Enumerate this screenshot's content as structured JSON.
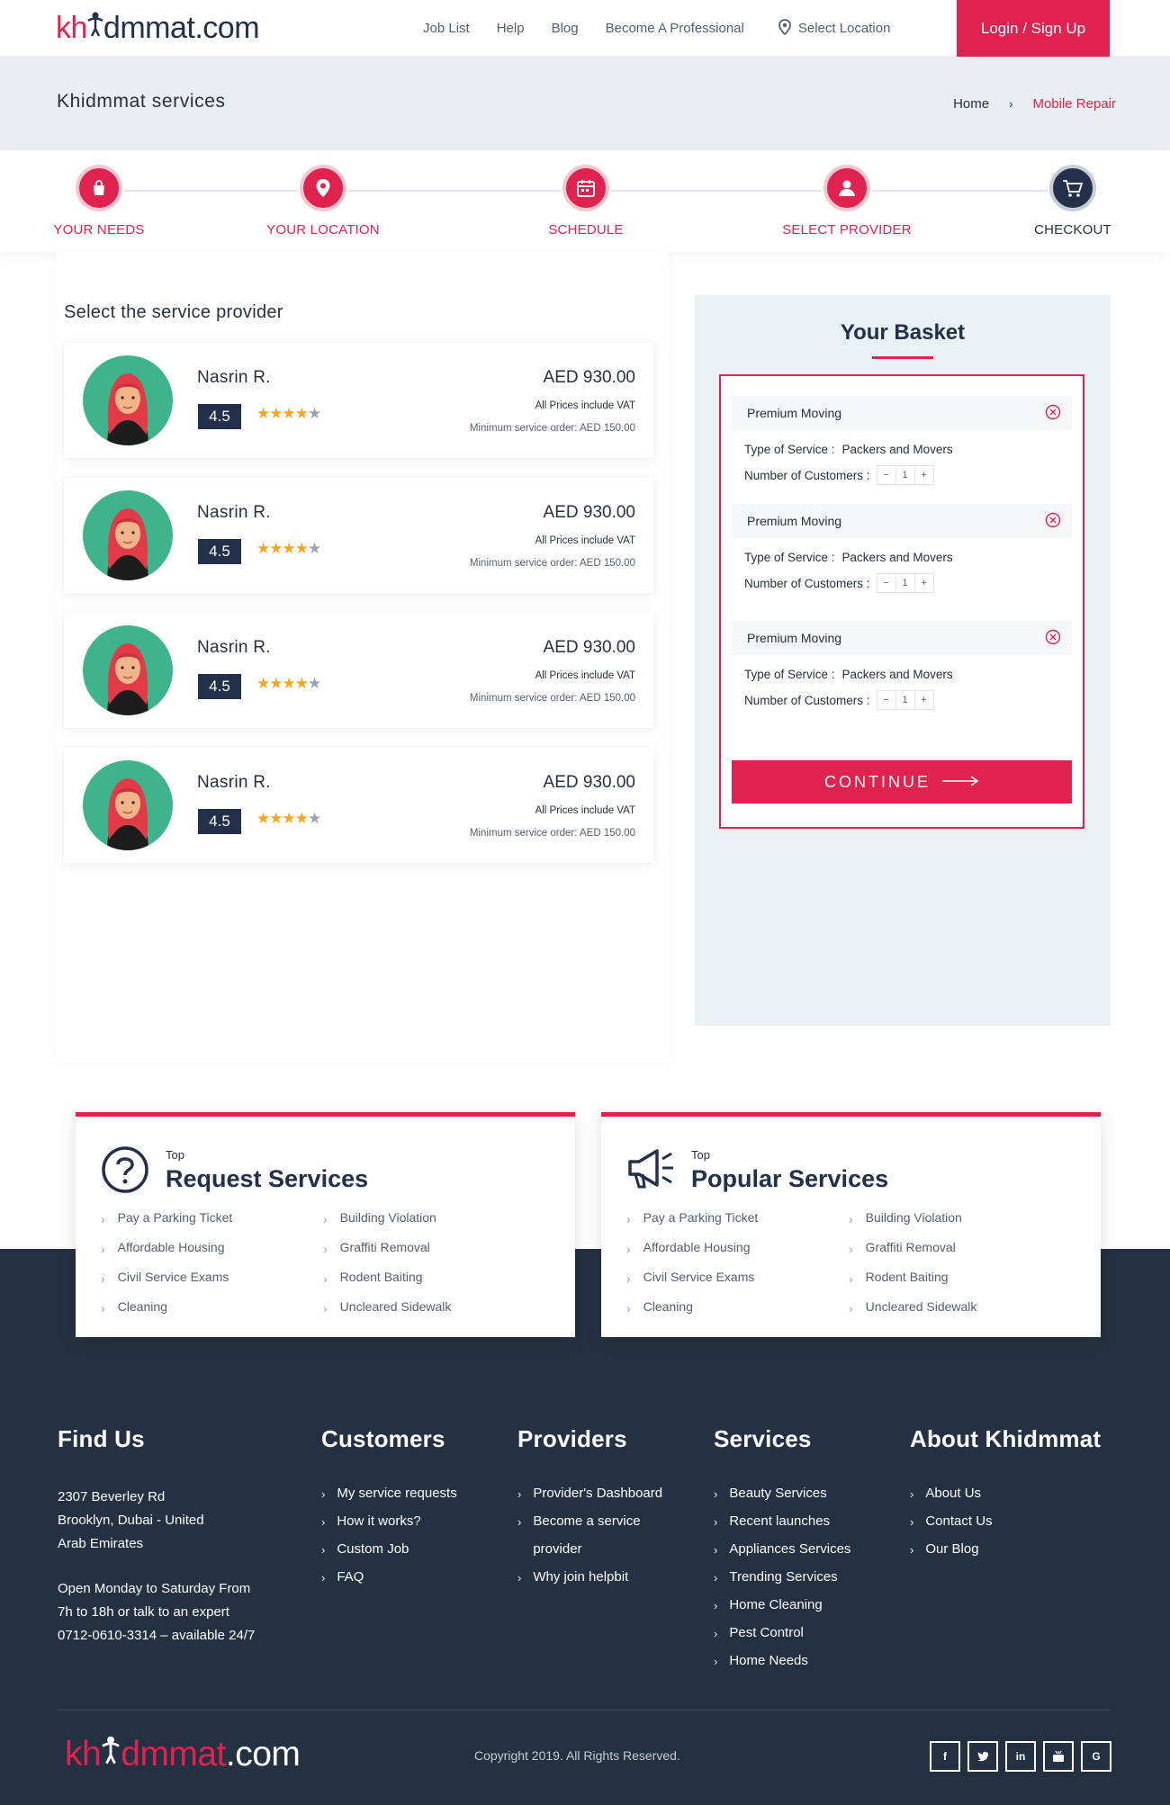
{
  "brand": {
    "logo_pre": "kh",
    "logo_post": "dmmat",
    "logo_tld": ".com"
  },
  "nav": {
    "job_list": "Job List",
    "help": "Help",
    "blog": "Blog",
    "become_pro": "Become A Professional",
    "location": "Select Location",
    "login": "Login / Sign Up"
  },
  "band": {
    "title": "Khidmmat services",
    "crumb_home": "Home",
    "crumb_sep": "›",
    "crumb_current": "Mobile Repair"
  },
  "steps": [
    {
      "label": "YOUR NEEDS",
      "icon": "shopping-bag-icon"
    },
    {
      "label": "YOUR LOCATION",
      "icon": "location-pin-icon"
    },
    {
      "label": "SCHEDULE",
      "icon": "calendar-icon"
    },
    {
      "label": "SELECT PROVIDER",
      "icon": "user-icon"
    },
    {
      "label": "CHECKOUT",
      "icon": "cart-icon"
    }
  ],
  "providers_heading": "Select the service provider",
  "providers": [
    {
      "name": "Nasrin R.",
      "rating": "4.5",
      "stars": "★★★★",
      "half": "★",
      "price": "AED 930.00",
      "vat": "All Prices include VAT",
      "min": "Minimum service order: AED 150.00"
    },
    {
      "name": "Nasrin R.",
      "rating": "4.5",
      "stars": "★★★★",
      "half": "★",
      "price": "AED 930.00",
      "vat": "All Prices include VAT",
      "min": "Minimum service order: AED 150.00"
    },
    {
      "name": "Nasrin R.",
      "rating": "4.5",
      "stars": "★★★★",
      "half": "★",
      "price": "AED 930.00",
      "vat": "All Prices include VAT",
      "min": "Minimum service order: AED 150.00"
    },
    {
      "name": "Nasrin R.",
      "rating": "4.5",
      "stars": "★★★★",
      "half": "★",
      "price": "AED 930.00",
      "vat": "All Prices include VAT",
      "min": "Minimum service order: AED 150.00"
    }
  ],
  "basket": {
    "title": "Your Basket",
    "type_label": "Type of Service :",
    "count_label": "Number of Customers :",
    "minus": "−",
    "plus": "+",
    "items": [
      {
        "name": "Premium Moving",
        "type": "Packers and Movers",
        "count": "1"
      },
      {
        "name": "Premium Moving",
        "type": "Packers and Movers",
        "count": "1"
      },
      {
        "name": "Premium Moving",
        "type": "Packers and Movers",
        "count": "1"
      }
    ],
    "continue": "CONTINUE"
  },
  "service_cards": [
    {
      "small": "Top",
      "big": "Request Services",
      "icon": "question-circle-icon",
      "col1": [
        "Pay a Parking Ticket",
        "Affordable Housing",
        "Civil Service Exams",
        "Cleaning"
      ],
      "col2": [
        "Building Violation",
        "Graffiti Removal",
        "Rodent Baiting",
        "Uncleared Sidewalk"
      ]
    },
    {
      "small": "Top",
      "big": "Popular Services",
      "icon": "megaphone-icon",
      "col1": [
        "Pay a Parking Ticket",
        "Affordable Housing",
        "Civil Service Exams",
        "Cleaning"
      ],
      "col2": [
        "Building Violation",
        "Graffiti Removal",
        "Rodent Baiting",
        "Uncleared Sidewalk"
      ]
    }
  ],
  "footer": {
    "find_us": {
      "title": "Find Us",
      "addr1": "2307 Beverley Rd",
      "addr2": "Brooklyn, Dubai - United",
      "addr3": "Arab Emirates",
      "hours1": "Open Monday to Saturday From",
      "hours2": "7h to 18h or talk to an expert",
      "hours3": "0712-0610-3314 – available 24/7"
    },
    "customers": {
      "title": "Customers",
      "links": [
        "My service requests",
        "How it works?",
        "Custom Job",
        "FAQ"
      ]
    },
    "providers": {
      "title": "Providers",
      "links": [
        "Provider's Dashboard",
        "Become a service",
        "provider",
        "Why join helpbit"
      ]
    },
    "services": {
      "title": "Services",
      "links": [
        "Beauty Services",
        "Recent launches",
        "Appliances Services",
        "Trending Services",
        "Home Cleaning",
        "Pest Control",
        "Home Needs"
      ]
    },
    "about": {
      "title": "About Khidmmat",
      "links": [
        "About Us",
        "Contact Us",
        "Our Blog"
      ]
    },
    "copyright": "Copyright 2019. All Rights Reserved.",
    "social": [
      "f",
      "t",
      "in",
      "yt",
      "G"
    ]
  },
  "colors": {
    "accent": "#e0234e",
    "navy": "#22304a",
    "footer_bg": "#243142",
    "band_bg": "#eaeef1",
    "basket_bg": "#e9f1f2"
  }
}
